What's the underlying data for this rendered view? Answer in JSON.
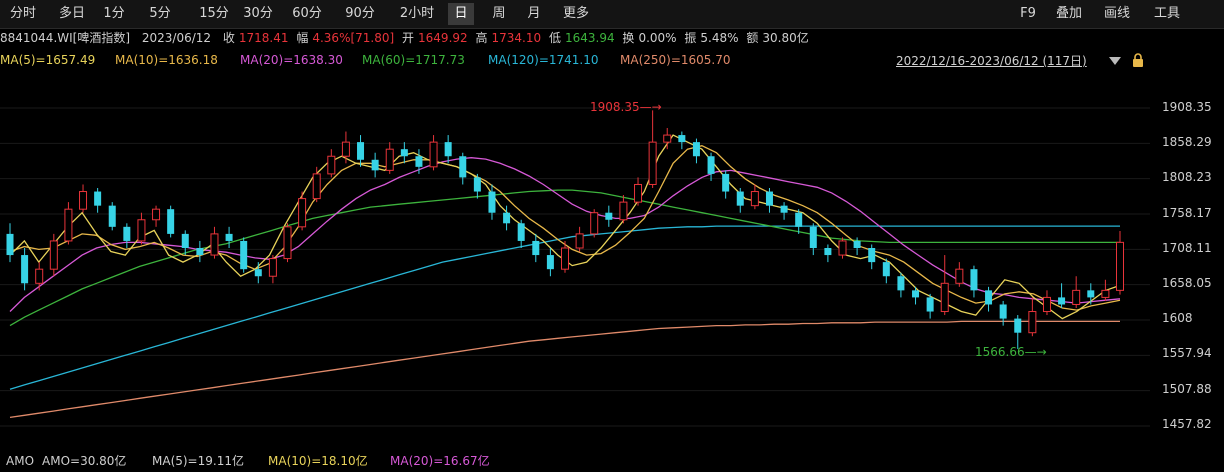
{
  "toolbar": {
    "timeframes": [
      "分时",
      "多日",
      "1分",
      "5分",
      "15分",
      "30分",
      "60分",
      "90分",
      "2小时",
      "日",
      "周",
      "月",
      "更多"
    ],
    "active": "日",
    "right": [
      "F9",
      "叠加",
      "画线",
      "工具"
    ]
  },
  "info": {
    "code_name": "8841044.WI[啤酒指数]",
    "date": "2023/06/12",
    "close_label": "收",
    "close": "1718.41",
    "chg_label": "幅",
    "chg": "4.36%[71.80]",
    "open_label": "开",
    "open": "1649.92",
    "high_label": "高",
    "high": "1734.10",
    "low_label": "低",
    "low": "1643.94",
    "turnover_label": "换",
    "turnover": "0.00%",
    "amp_label": "振",
    "amp": "5.48%",
    "amount_label": "额",
    "amount": "30.80亿"
  },
  "ma_legend": [
    {
      "text": "MA(5)=1657.49",
      "color": "#e8d35a"
    },
    {
      "text": "MA(10)=1636.18",
      "color": "#e8b84a"
    },
    {
      "text": "MA(20)=1638.30",
      "color": "#d659d6"
    },
    {
      "text": "MA(60)=1717.73",
      "color": "#3db33d"
    },
    {
      "text": "MA(120)=1741.10",
      "color": "#29b6d6"
    },
    {
      "text": "MA(250)=1605.70",
      "color": "#e08a6a"
    }
  ],
  "range_text": "2022/12/16-2023/06/12 (117日)",
  "y_labels": [
    "1908.35",
    "1858.29",
    "1808.23",
    "1758.17",
    "1708.11",
    "1658.05",
    "1608",
    "1557.94",
    "1507.88",
    "1457.82"
  ],
  "annotations": {
    "high": "1908.35",
    "low": "1566.66"
  },
  "bottom": [
    {
      "text": "AMO",
      "color": "#cfcfcf"
    },
    {
      "text": "AMO=30.80亿",
      "color": "#cfcfcf"
    },
    {
      "text": "MA(5)=19.11亿",
      "color": "#cfcfcf"
    },
    {
      "text": "MA(10)=18.10亿",
      "color": "#e8d35a"
    },
    {
      "text": "MA(20)=16.67亿",
      "color": "#d659d6"
    }
  ],
  "colors": {
    "up": "#e8343a",
    "down": "#37d3e6",
    "ma5": "#e8d35a",
    "ma10": "#e8b84a",
    "ma20": "#d659d6",
    "ma60": "#3db33d",
    "ma120": "#29b6d6",
    "ma250": "#e08a6a"
  },
  "chart_data": {
    "type": "candlestick",
    "y_ticks": [
      1908.35,
      1858.29,
      1808.23,
      1758.17,
      1708.11,
      1658.05,
      1608,
      1557.94,
      1507.88,
      1457.82
    ],
    "high": 1908.35,
    "low": 1566.66,
    "last_close": 1718.41,
    "ma_lines": {
      "ma5": [
        1700,
        1720,
        1690,
        1715,
        1740,
        1760,
        1730,
        1705,
        1700,
        1725,
        1735,
        1700,
        1690,
        1700,
        1715,
        1690,
        1670,
        1680,
        1700,
        1740,
        1775,
        1810,
        1830,
        1840,
        1830,
        1825,
        1820,
        1840,
        1845,
        1835,
        1830,
        1825,
        1815,
        1800,
        1770,
        1750,
        1735,
        1720,
        1700,
        1685,
        1690,
        1710,
        1735,
        1760,
        1790,
        1840,
        1870,
        1860,
        1850,
        1825,
        1800,
        1780,
        1775,
        1770,
        1765,
        1760,
        1745,
        1720,
        1700,
        1695,
        1700,
        1690,
        1670,
        1650,
        1640,
        1630,
        1620,
        1615,
        1640,
        1665,
        1660,
        1640,
        1625,
        1610,
        1620,
        1635,
        1650,
        1657
      ],
      "ma10": [
        1705,
        1712,
        1708,
        1710,
        1720,
        1730,
        1728,
        1715,
        1708,
        1712,
        1718,
        1710,
        1700,
        1698,
        1705,
        1700,
        1688,
        1680,
        1688,
        1710,
        1740,
        1775,
        1800,
        1820,
        1830,
        1830,
        1825,
        1830,
        1835,
        1835,
        1830,
        1825,
        1815,
        1805,
        1790,
        1770,
        1752,
        1738,
        1722,
        1708,
        1700,
        1702,
        1714,
        1732,
        1752,
        1790,
        1830,
        1850,
        1855,
        1845,
        1825,
        1808,
        1795,
        1785,
        1778,
        1770,
        1760,
        1745,
        1728,
        1712,
        1705,
        1700,
        1690,
        1675,
        1660,
        1650,
        1640,
        1632,
        1635,
        1645,
        1648,
        1645,
        1635,
        1625,
        1622,
        1628,
        1632,
        1636
      ],
      "ma20": [
        1620,
        1640,
        1655,
        1670,
        1685,
        1700,
        1710,
        1715,
        1718,
        1718,
        1716,
        1714,
        1712,
        1708,
        1706,
        1704,
        1700,
        1696,
        1694,
        1700,
        1712,
        1730,
        1748,
        1765,
        1780,
        1792,
        1800,
        1810,
        1818,
        1826,
        1832,
        1836,
        1838,
        1836,
        1830,
        1822,
        1812,
        1800,
        1786,
        1772,
        1762,
        1756,
        1752,
        1752,
        1756,
        1768,
        1784,
        1798,
        1810,
        1818,
        1820,
        1816,
        1812,
        1808,
        1804,
        1800,
        1796,
        1788,
        1776,
        1762,
        1746,
        1730,
        1714,
        1700,
        1686,
        1674,
        1662,
        1652,
        1646,
        1644,
        1640,
        1638,
        1636,
        1634,
        1632,
        1634,
        1636,
        1638
      ],
      "ma60": [
        1600,
        1612,
        1622,
        1632,
        1642,
        1652,
        1660,
        1668,
        1676,
        1684,
        1690,
        1696,
        1702,
        1708,
        1712,
        1716,
        1722,
        1728,
        1734,
        1740,
        1746,
        1752,
        1756,
        1760,
        1764,
        1768,
        1770,
        1772,
        1774,
        1776,
        1778,
        1780,
        1782,
        1784,
        1786,
        1788,
        1790,
        1791,
        1792,
        1792,
        1790,
        1788,
        1784,
        1780,
        1776,
        1772,
        1768,
        1764,
        1760,
        1756,
        1752,
        1748,
        1744,
        1740,
        1736,
        1732,
        1728,
        1724,
        1722,
        1720,
        1719,
        1718,
        1718,
        1718,
        1718,
        1718,
        1718,
        1718,
        1718,
        1718,
        1718,
        1718,
        1718,
        1718,
        1718,
        1718,
        1718,
        1718
      ],
      "ma120": [
        1510,
        1516,
        1522,
        1528,
        1534,
        1540,
        1546,
        1552,
        1558,
        1564,
        1570,
        1576,
        1582,
        1588,
        1594,
        1600,
        1606,
        1612,
        1618,
        1624,
        1630,
        1636,
        1642,
        1648,
        1654,
        1660,
        1666,
        1672,
        1678,
        1684,
        1690,
        1694,
        1698,
        1702,
        1706,
        1710,
        1714,
        1718,
        1722,
        1726,
        1728,
        1730,
        1732,
        1734,
        1736,
        1738,
        1739,
        1740,
        1740,
        1741,
        1741,
        1741,
        1741,
        1741,
        1741,
        1741,
        1741,
        1741,
        1741,
        1741,
        1741,
        1741,
        1741,
        1741,
        1741,
        1741,
        1741,
        1741,
        1741,
        1741,
        1741,
        1741,
        1741,
        1741,
        1741,
        1741,
        1741,
        1741
      ],
      "ma250": [
        1470,
        1473,
        1476,
        1479,
        1482,
        1485,
        1488,
        1491,
        1494,
        1497,
        1500,
        1503,
        1506,
        1509,
        1512,
        1515,
        1518,
        1521,
        1524,
        1527,
        1530,
        1533,
        1536,
        1539,
        1542,
        1545,
        1548,
        1551,
        1554,
        1557,
        1560,
        1563,
        1566,
        1569,
        1572,
        1575,
        1578,
        1580,
        1582,
        1584,
        1586,
        1588,
        1590,
        1592,
        1594,
        1596,
        1597,
        1598,
        1599,
        1600,
        1600,
        1601,
        1601,
        1602,
        1602,
        1603,
        1603,
        1604,
        1604,
        1604,
        1605,
        1605,
        1605,
        1605,
        1605,
        1605,
        1606,
        1606,
        1606,
        1606,
        1606,
        1606,
        1606,
        1606,
        1606,
        1606,
        1606,
        1606
      ]
    },
    "candles": [
      [
        1730,
        1700,
        1745,
        1690
      ],
      [
        1700,
        1660,
        1710,
        1650
      ],
      [
        1660,
        1680,
        1690,
        1650
      ],
      [
        1680,
        1720,
        1730,
        1670
      ],
      [
        1720,
        1765,
        1775,
        1715
      ],
      [
        1765,
        1790,
        1800,
        1760
      ],
      [
        1790,
        1770,
        1795,
        1760
      ],
      [
        1770,
        1740,
        1775,
        1735
      ],
      [
        1740,
        1720,
        1745,
        1710
      ],
      [
        1720,
        1750,
        1760,
        1715
      ],
      [
        1750,
        1765,
        1770,
        1740
      ],
      [
        1765,
        1730,
        1770,
        1725
      ],
      [
        1730,
        1710,
        1735,
        1700
      ],
      [
        1710,
        1700,
        1720,
        1690
      ],
      [
        1700,
        1730,
        1740,
        1695
      ],
      [
        1730,
        1720,
        1740,
        1710
      ],
      [
        1720,
        1680,
        1725,
        1675
      ],
      [
        1680,
        1670,
        1690,
        1660
      ],
      [
        1670,
        1695,
        1700,
        1660
      ],
      [
        1695,
        1740,
        1745,
        1690
      ],
      [
        1740,
        1780,
        1790,
        1735
      ],
      [
        1780,
        1815,
        1825,
        1775
      ],
      [
        1815,
        1840,
        1850,
        1810
      ],
      [
        1840,
        1860,
        1875,
        1830
      ],
      [
        1860,
        1835,
        1870,
        1825
      ],
      [
        1835,
        1820,
        1845,
        1810
      ],
      [
        1820,
        1850,
        1860,
        1815
      ],
      [
        1850,
        1840,
        1860,
        1830
      ],
      [
        1840,
        1825,
        1850,
        1815
      ],
      [
        1825,
        1860,
        1870,
        1820
      ],
      [
        1860,
        1840,
        1870,
        1830
      ],
      [
        1840,
        1810,
        1845,
        1800
      ],
      [
        1810,
        1790,
        1815,
        1780
      ],
      [
        1790,
        1760,
        1800,
        1750
      ],
      [
        1760,
        1745,
        1770,
        1735
      ],
      [
        1745,
        1720,
        1750,
        1710
      ],
      [
        1720,
        1700,
        1730,
        1690
      ],
      [
        1700,
        1680,
        1710,
        1670
      ],
      [
        1680,
        1710,
        1720,
        1675
      ],
      [
        1710,
        1730,
        1740,
        1705
      ],
      [
        1730,
        1760,
        1765,
        1725
      ],
      [
        1760,
        1750,
        1770,
        1740
      ],
      [
        1750,
        1775,
        1785,
        1745
      ],
      [
        1775,
        1800,
        1810,
        1770
      ],
      [
        1800,
        1860,
        1905,
        1795
      ],
      [
        1860,
        1870,
        1880,
        1850
      ],
      [
        1870,
        1860,
        1875,
        1850
      ],
      [
        1860,
        1840,
        1865,
        1830
      ],
      [
        1840,
        1815,
        1845,
        1805
      ],
      [
        1815,
        1790,
        1820,
        1780
      ],
      [
        1790,
        1770,
        1795,
        1760
      ],
      [
        1770,
        1790,
        1800,
        1765
      ],
      [
        1790,
        1770,
        1795,
        1760
      ],
      [
        1770,
        1760,
        1775,
        1750
      ],
      [
        1760,
        1740,
        1765,
        1730
      ],
      [
        1740,
        1710,
        1745,
        1700
      ],
      [
        1710,
        1700,
        1715,
        1690
      ],
      [
        1700,
        1720,
        1725,
        1695
      ],
      [
        1720,
        1710,
        1725,
        1700
      ],
      [
        1710,
        1690,
        1715,
        1680
      ],
      [
        1690,
        1670,
        1695,
        1660
      ],
      [
        1670,
        1650,
        1675,
        1640
      ],
      [
        1650,
        1640,
        1655,
        1630
      ],
      [
        1640,
        1620,
        1645,
        1610
      ],
      [
        1620,
        1660,
        1700,
        1615
      ],
      [
        1660,
        1680,
        1690,
        1655
      ],
      [
        1680,
        1650,
        1685,
        1640
      ],
      [
        1650,
        1630,
        1655,
        1620
      ],
      [
        1630,
        1610,
        1635,
        1600
      ],
      [
        1610,
        1590,
        1615,
        1567
      ],
      [
        1590,
        1620,
        1640,
        1585
      ],
      [
        1620,
        1640,
        1650,
        1615
      ],
      [
        1640,
        1630,
        1660,
        1625
      ],
      [
        1630,
        1650,
        1670,
        1625
      ],
      [
        1650,
        1640,
        1660,
        1630
      ],
      [
        1640,
        1650,
        1665,
        1635
      ],
      [
        1650,
        1718,
        1734,
        1644
      ]
    ]
  }
}
